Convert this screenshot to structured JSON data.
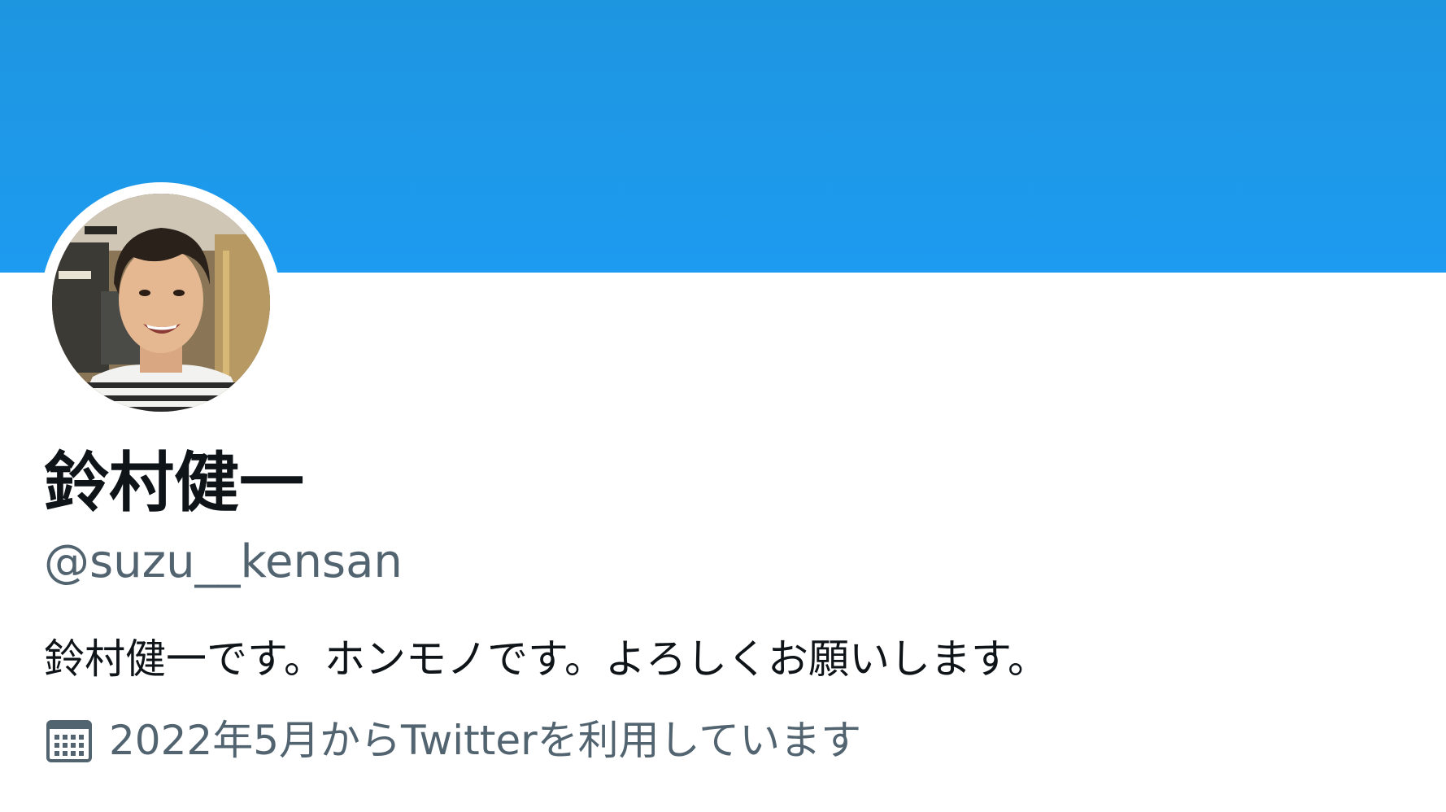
{
  "profile": {
    "display_name": "鈴村健一",
    "handle": "@suzu__kensan",
    "bio": "鈴村健一です。ホンモノです。よろしくお願いします。",
    "joined": "2022年5月からTwitterを利用しています"
  },
  "icons": {
    "joined": "calendar-icon",
    "avatar": "profile-photo"
  },
  "colors": {
    "banner": "#1d9bf0",
    "name_text": "#0f1419",
    "secondary_text": "#536471",
    "background": "#ffffff"
  }
}
